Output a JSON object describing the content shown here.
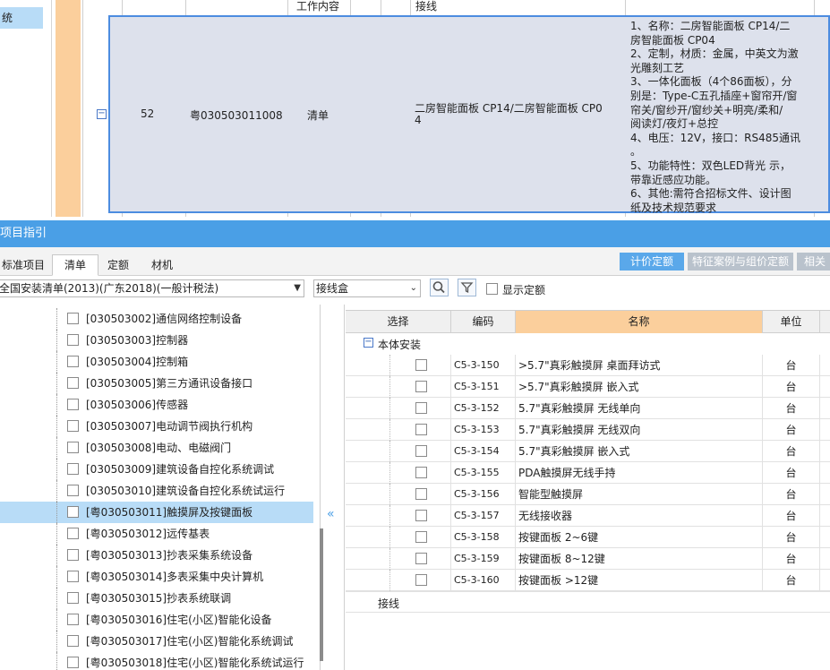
{
  "top_grid": {
    "left_nav_item": "统",
    "header_work": "工作内容",
    "header_wire": "接线",
    "row": {
      "seq": "52",
      "code": "粤030503011008",
      "type": "清单",
      "name_line1": "二房智能面板 CP14/二房智能面板 CP0",
      "name_line2": "4",
      "desc_lines": [
        "1、名称：二房智能面板 CP14/二",
        "房智能面板 CP04",
        "2、定制，材质：金属，中英文为激",
        "光雕刻工艺",
        "3、一体化面板（4个86面板），分",
        "别是：Type-C五孔插座+窗帘开/窗",
        "帘关/窗纱开/窗纱关+明亮/柔和/",
        "阅读灯/夜灯+总控",
        "4、电压：12V，接口：RS485通讯",
        "。",
        "5、功能特性：双色LED背光 示，",
        "带靠近感应功能。",
        "6、其他:需符合招标文件、设计图",
        "纸及技术规范要求"
      ]
    }
  },
  "panel": {
    "title": "项目指引",
    "tabs": [
      "标准项目",
      "清单",
      "定额",
      "材机"
    ],
    "active_tab": 1,
    "right_buttons": [
      "计价定额",
      "特征案例与组价定额",
      "相关"
    ],
    "toolbar": {
      "library_select": "全国安装清单(2013)(广东2018)(一般计税法)",
      "keyword_select": "接线盒",
      "show_quota_label": "显示定额"
    },
    "tree_items": [
      "[030503002]通信网络控制设备",
      "[030503003]控制器",
      "[030503004]控制箱",
      "[030503005]第三方通讯设备接口",
      "[030503006]传感器",
      "[030503007]电动调节阀执行机构",
      "[030503008]电动、电磁阀门",
      "[030503009]建筑设备自控化系统调试",
      "[030503010]建筑设备自控化系统试运行",
      "[粤030503011]触摸屏及按键面板",
      "[粤030503012]远传基表",
      "[粤030503013]抄表采集系统设备",
      "[粤030503014]多表采集中央计算机",
      "[粤030503015]抄表系统联调",
      "[粤030503016]住宅(小区)智能化设备",
      "[粤030503017]住宅(小区)智能化系统调试",
      "[粤030503018]住宅(小区)智能化系统试运行"
    ],
    "tree_selected_index": 9,
    "grid": {
      "headers": [
        "选择",
        "编码",
        "名称",
        "单位"
      ],
      "group_label": "本体安装",
      "rows": [
        {
          "code": "C5-3-150",
          "name": ">5.7\"真彩触摸屏 桌面拜访式",
          "unit": "台"
        },
        {
          "code": "C5-3-151",
          "name": ">5.7\"真彩触摸屏 嵌入式",
          "unit": "台"
        },
        {
          "code": "C5-3-152",
          "name": "5.7\"真彩触摸屏 无线单向",
          "unit": "台"
        },
        {
          "code": "C5-3-153",
          "name": "5.7\"真彩触摸屏 无线双向",
          "unit": "台"
        },
        {
          "code": "C5-3-154",
          "name": "5.7\"真彩触摸屏 嵌入式",
          "unit": "台"
        },
        {
          "code": "C5-3-155",
          "name": "PDA触摸屏无线手持",
          "unit": "台"
        },
        {
          "code": "C5-3-156",
          "name": "智能型触摸屏",
          "unit": "台"
        },
        {
          "code": "C5-3-157",
          "name": "无线接收器",
          "unit": "台"
        },
        {
          "code": "C5-3-158",
          "name": "按键面板 2~6键",
          "unit": "台"
        },
        {
          "code": "C5-3-159",
          "name": "按键面板 8~12键",
          "unit": "台"
        },
        {
          "code": "C5-3-160",
          "name": "按键面板 >12键",
          "unit": "台"
        }
      ],
      "footer_label": "接线"
    }
  },
  "colors": {
    "accent": "#4a9fe6",
    "selection": "#b8dcf7",
    "orange": "#fbcf9c",
    "row_selected": "#dde1ec"
  }
}
